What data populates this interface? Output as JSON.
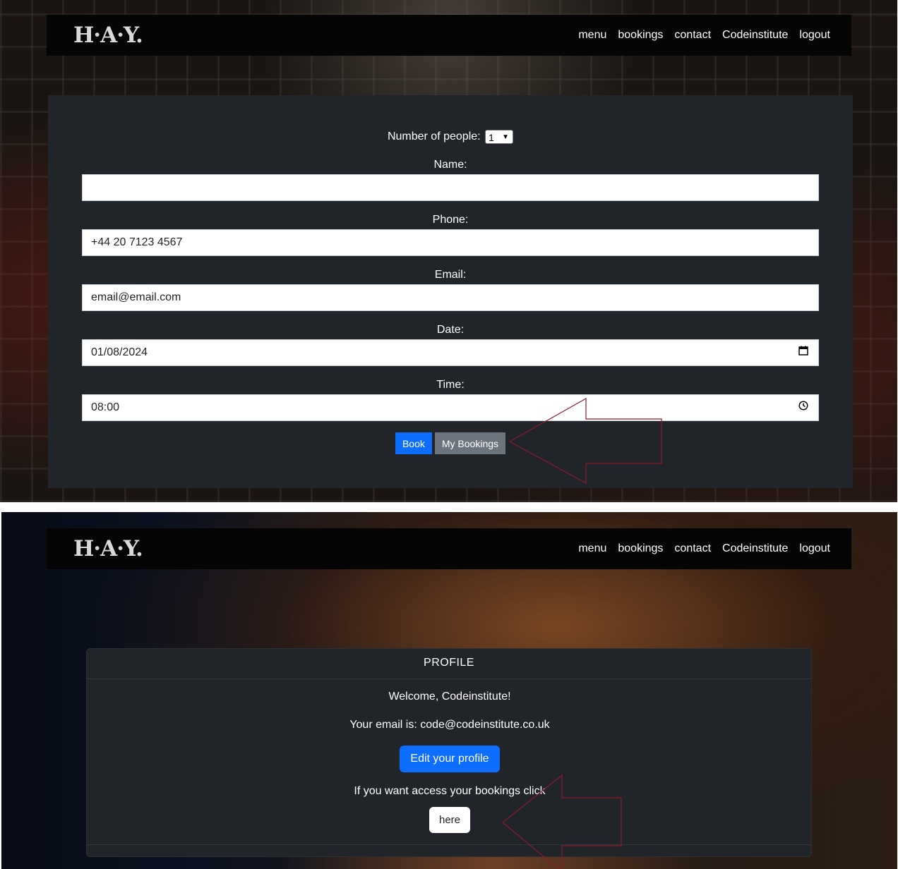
{
  "brand": "H·A·Y.",
  "nav": [
    "menu",
    "bookings",
    "contact",
    "Codeinstitute",
    "logout"
  ],
  "booking_form": {
    "people_label": "Number of people:",
    "people_value": "1",
    "name_label": "Name:",
    "name_value": "",
    "phone_label": "Phone:",
    "phone_value": "+44 20 7123 4567",
    "email_label": "Email:",
    "email_value": "email@email.com",
    "date_label": "Date:",
    "date_value": "01/08/2024",
    "time_label": "Time:",
    "time_value": "08:00",
    "book_button": "Book",
    "my_bookings_button": "My Bookings"
  },
  "profile": {
    "title": "PROFILE",
    "welcome": "Welcome, Codeinstitute!",
    "email_text": "Your email is: code@codeinstitute.co.uk",
    "edit_button": "Edit your profile",
    "bookings_prompt": "If you want access your bookings click",
    "here_button": "here"
  },
  "colors": {
    "card_bg": "#212529",
    "primary": "#0d6efd",
    "secondary": "#6c757d",
    "arrow": "#8b1a2b"
  },
  "icons": {
    "calendar": "calendar-icon",
    "clock": "clock-icon",
    "dropdown": "chevron-down-icon"
  }
}
